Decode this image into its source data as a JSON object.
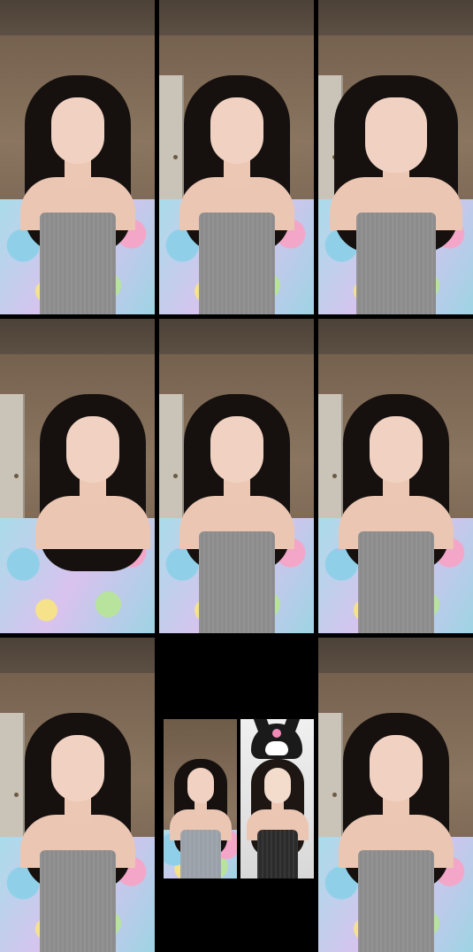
{
  "grid": {
    "rows": 3,
    "columns": 3,
    "tiles": [
      {
        "id": "r1c1",
        "kind": "video"
      },
      {
        "id": "r1c2",
        "kind": "video"
      },
      {
        "id": "r1c3",
        "kind": "video"
      },
      {
        "id": "r2c1",
        "kind": "video"
      },
      {
        "id": "r2c2",
        "kind": "video"
      },
      {
        "id": "r2c3",
        "kind": "video"
      },
      {
        "id": "r3c1",
        "kind": "video"
      },
      {
        "id": "r3c2",
        "kind": "split-video",
        "panes": [
          "host",
          "guest"
        ]
      },
      {
        "id": "r3c3",
        "kind": "video"
      }
    ]
  },
  "colors": {
    "background": "#000000",
    "wall": "#8a7560",
    "top_grey": "#8c8c8c",
    "hair": "#16110f",
    "skin": "#f1d2c2"
  }
}
